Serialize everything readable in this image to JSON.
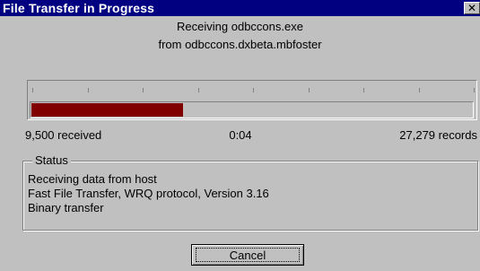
{
  "window": {
    "title": "File Transfer in Progress",
    "close_glyph": "✕",
    "close_icon": "close-icon"
  },
  "transfer": {
    "line1": "Receiving odbccons.exe",
    "line2": "from odbccons.dxbeta.mbfoster"
  },
  "progress": {
    "fraction": 0.345,
    "fill_color": "#800000",
    "tick_count": 9
  },
  "stats": {
    "received": "9,500 received",
    "elapsed": "0:04",
    "total": "27,279 records"
  },
  "status": {
    "legend": "Status",
    "lines": [
      "Receiving data from host",
      "Fast File Transfer, WRQ protocol, Version 3.16",
      "Binary transfer"
    ]
  },
  "buttons": {
    "cancel": "Cancel"
  },
  "colors": {
    "titlebar": "#000080",
    "dialog": "#c0c0c0"
  }
}
